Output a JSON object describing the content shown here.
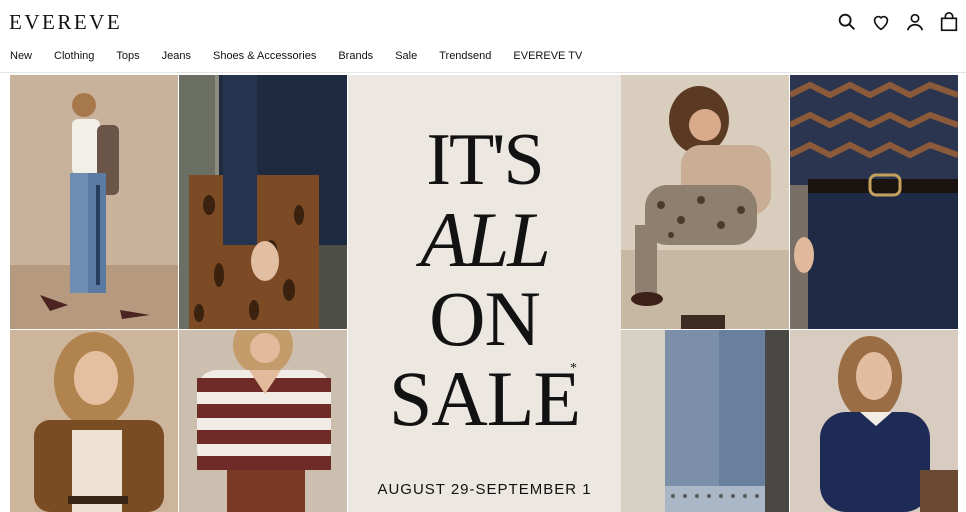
{
  "brand": {
    "logo": "EVEREVE"
  },
  "header": {
    "icons": [
      "search-icon",
      "heart-icon",
      "account-icon",
      "bag-icon"
    ]
  },
  "nav": {
    "items": [
      "New",
      "Clothing",
      "Tops",
      "Jeans",
      "Shoes & Accessories",
      "Brands",
      "Sale",
      "Trendsend",
      "EVEREVE TV"
    ]
  },
  "hero": {
    "line1": "IT'S",
    "line2": "ALL",
    "line3": "ON",
    "line4": "SALE",
    "asterisk": "*",
    "dates": "AUGUST 29-SEPTEMBER 1"
  },
  "colors": {
    "hero_bg": "#ece8e1",
    "text": "#111111"
  }
}
